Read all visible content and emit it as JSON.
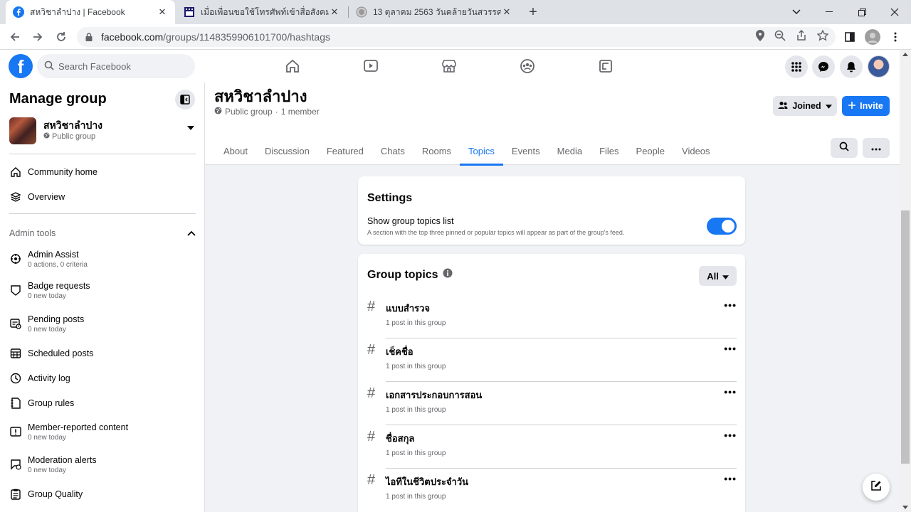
{
  "browser": {
    "tabs": [
      {
        "title": "สหวิชาลำปาง | Facebook"
      },
      {
        "title": "เมื่อเพื่อนขอใช้โทรศัพท์เข้าสื่อสังคม : บ"
      },
      {
        "title": "13 ตุลาคม 2563 วันคล้ายวันสวรรคต"
      }
    ],
    "url_host": "facebook.com",
    "url_path": "/groups/1148359906101700/hashtags"
  },
  "fb": {
    "search_placeholder": "Search Facebook"
  },
  "sidebar": {
    "title": "Manage group",
    "group_name": "สหวิชาลำปาง",
    "group_privacy": "Public group",
    "items_top": [
      {
        "label": "Community home"
      },
      {
        "label": "Overview"
      }
    ],
    "admin_section": "Admin tools",
    "admin_items": [
      {
        "label": "Admin Assist",
        "sub": "0 actions, 0 criteria"
      },
      {
        "label": "Badge requests",
        "sub": "0 new today"
      },
      {
        "label": "Pending posts",
        "sub": "0 new today"
      },
      {
        "label": "Scheduled posts",
        "sub": ""
      },
      {
        "label": "Activity log",
        "sub": ""
      },
      {
        "label": "Group rules",
        "sub": ""
      },
      {
        "label": "Member-reported content",
        "sub": "0 new today"
      },
      {
        "label": "Moderation alerts",
        "sub": "0 new today"
      },
      {
        "label": "Group Quality",
        "sub": ""
      }
    ]
  },
  "group": {
    "name": "สหวิชาลำปาง",
    "privacy": "Public group",
    "members": "1 member",
    "joined_label": "Joined",
    "invite_label": "Invite",
    "tabs": [
      {
        "label": "About"
      },
      {
        "label": "Discussion"
      },
      {
        "label": "Featured"
      },
      {
        "label": "Chats"
      },
      {
        "label": "Rooms"
      },
      {
        "label": "Topics"
      },
      {
        "label": "Events"
      },
      {
        "label": "Media"
      },
      {
        "label": "Files"
      },
      {
        "label": "People"
      },
      {
        "label": "Videos"
      }
    ],
    "active_tab": "Topics"
  },
  "settings": {
    "title": "Settings",
    "option_label": "Show group topics list",
    "option_desc": "A section with the top three pinned or popular topics will appear as part of the group's feed.",
    "enabled": true
  },
  "topics": {
    "title": "Group topics",
    "filter_label": "All",
    "items": [
      {
        "name": "แบบสำรวจ",
        "count": "1 post in this group"
      },
      {
        "name": "เช็คชื่อ",
        "count": "1 post in this group"
      },
      {
        "name": "เอกสารประกอบการสอน",
        "count": "1 post in this group"
      },
      {
        "name": "ชื่อสกุล",
        "count": "1 post in this group"
      },
      {
        "name": "ไอทีในชีวิตประจำวัน",
        "count": "1 post in this group"
      }
    ]
  },
  "colors": {
    "accent": "#1877f2"
  }
}
